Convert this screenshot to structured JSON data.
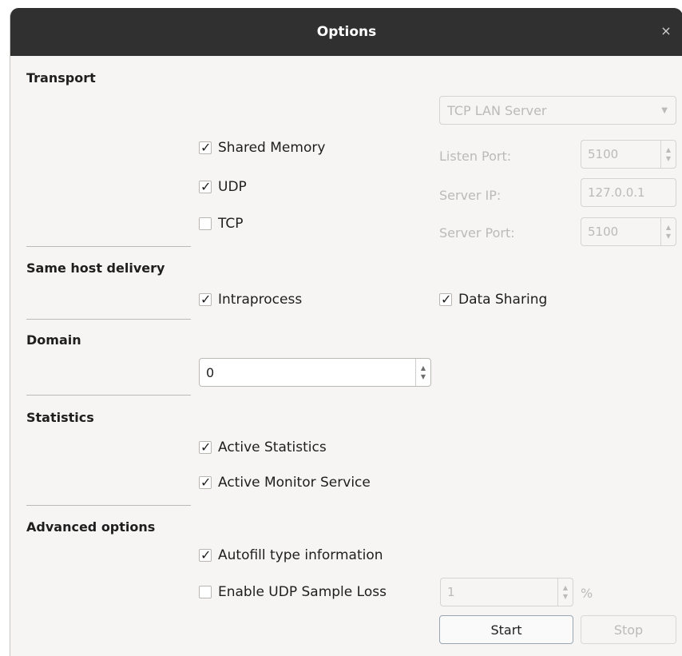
{
  "window": {
    "title": "Options",
    "close_glyph": "×"
  },
  "transport": {
    "heading": "Transport",
    "shared_memory": {
      "label": "Shared Memory",
      "checked": true
    },
    "udp": {
      "label": "UDP",
      "checked": true
    },
    "tcp": {
      "label": "TCP",
      "checked": false
    },
    "tcp_mode": "TCP LAN Server",
    "listen_port_label": "Listen Port:",
    "listen_port_value": "5100",
    "server_ip_label": "Server IP:",
    "server_ip_value": "127.0.0.1",
    "server_port_label": "Server Port:",
    "server_port_value": "5100"
  },
  "same_host": {
    "heading": "Same host delivery",
    "intraprocess": {
      "label": "Intraprocess",
      "checked": true
    },
    "data_sharing": {
      "label": "Data Sharing",
      "checked": true
    }
  },
  "domain": {
    "heading": "Domain",
    "value": "0"
  },
  "statistics": {
    "heading": "Statistics",
    "active_statistics": {
      "label": "Active Statistics",
      "checked": true
    },
    "active_monitor": {
      "label": "Active Monitor Service",
      "checked": true
    }
  },
  "advanced": {
    "heading": "Advanced options",
    "autofill": {
      "label": "Autofill type information",
      "checked": true
    },
    "udp_loss": {
      "label": "Enable UDP Sample Loss",
      "checked": false
    },
    "udp_loss_value": "1",
    "udp_loss_unit": "%"
  },
  "buttons": {
    "start": "Start",
    "stop": "Stop"
  },
  "glyphs": {
    "check": "✓",
    "up": "▲",
    "down": "▼",
    "dropdown": "▼"
  },
  "colors": {
    "titlebar": "#303030",
    "window_bg": "#f6f5f4",
    "disabled_text": "#bcbab6"
  }
}
